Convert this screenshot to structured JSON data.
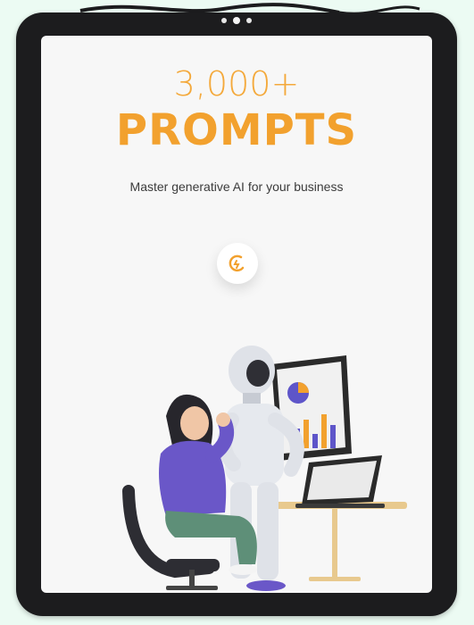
{
  "hero": {
    "count": "3,000+",
    "headline": "PROMPTS",
    "subtitle": "Master generative AI for your business"
  },
  "icons": [
    "camera-icon",
    "logo-icon",
    "robot-illustration",
    "woman-illustration",
    "monitor-chart-illustration",
    "laptop-illustration",
    "chair-illustration",
    "table-illustration"
  ],
  "colors": {
    "accent": "#f2a12e",
    "bezel": "#1c1c1e",
    "screen": "#f7f7f7",
    "background": "#ecfbf3",
    "sweater": "#6a57c8",
    "pants": "#5e8f78"
  }
}
